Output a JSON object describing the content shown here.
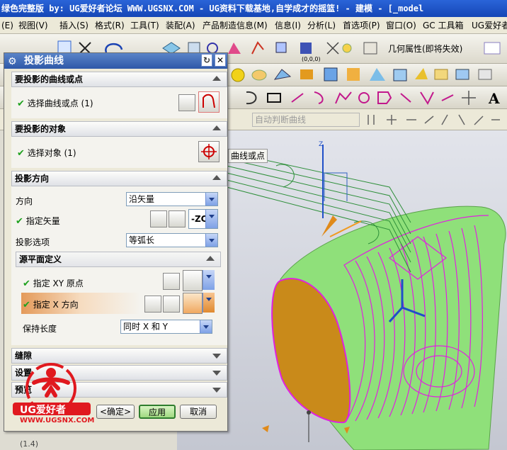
{
  "window": {
    "title": "绿色完整版   by: UG爱好者论坛  WWW.UGSNX.COM - UG资料下载基地,自学成才的摇篮! - 建模 - [_model"
  },
  "menubar": {
    "items": [
      {
        "label": "(E)"
      },
      {
        "label": "视图(V)"
      },
      {
        "label": "插入(S)"
      },
      {
        "label": "格式(R)"
      },
      {
        "label": "工具(T)"
      },
      {
        "label": "装配(A)"
      },
      {
        "label": "产品制造信息(M)"
      },
      {
        "label": "信息(I)"
      },
      {
        "label": "分析(L)"
      },
      {
        "label": "首选项(P)"
      },
      {
        "label": "窗口(O)"
      },
      {
        "label": "GC 工具箱"
      },
      {
        "label": "UG爱好者"
      }
    ]
  },
  "toolbar": {
    "property_label": "几何属性(即将失效)",
    "filter_placeholder": "自动判断曲线",
    "coord_label": "(0,0,0)"
  },
  "viewport": {
    "tooltip": "曲线或点"
  },
  "dialog": {
    "title": "投影曲线",
    "sections": {
      "curves_header": "要投影的曲线或点",
      "curves_select": "选择曲线或点 (1)",
      "objects_header": "要投影的对象",
      "objects_select": "选择对象 (1)",
      "direction_header": "投影方向",
      "direction_label": "方向",
      "direction_value": "沿矢量",
      "vector_label": "指定矢量",
      "vector_value": "-ZC",
      "option_label": "投影选项",
      "option_value": "等弧长",
      "plane_header": "源平面定义",
      "xy_origin_label": "指定 XY 原点",
      "x_dir_label": "指定 X 方向",
      "keep_length_label": "保持长度",
      "keep_length_value": "同时 X 和 Y",
      "gap_header": "缝隙",
      "settings_header": "设置",
      "preview_header": "预览"
    },
    "buttons": {
      "ok": "<确定>",
      "apply": "应用",
      "cancel": "取消"
    }
  },
  "logo": {
    "text": "UG爱好者",
    "url": "WWW.UGSNX.COM"
  },
  "status": {
    "text": "(1.4)"
  },
  "colors": {
    "title_blue": "#1546b6",
    "solid_green": "#8fe07a",
    "curve_magenta": "#e020e0",
    "face_orange": "#c98a1a",
    "check_green": "#1ea11e",
    "logo_red": "#e0191f"
  }
}
